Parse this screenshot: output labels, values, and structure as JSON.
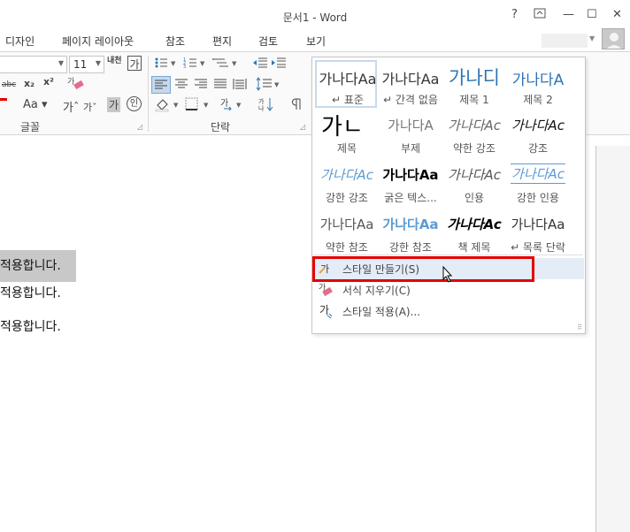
{
  "window": {
    "title": "문서1 - Word",
    "help": "?",
    "minimize": "—",
    "maximize": "☐",
    "close": "✕"
  },
  "tabs": [
    "디자인",
    "페이지 레이아웃",
    "참조",
    "편지",
    "검토",
    "보기"
  ],
  "ribbon": {
    "font_size": "11",
    "groups": [
      "글꼴",
      "단락"
    ],
    "hangul_label": "내천"
  },
  "document": {
    "lines": [
      "적용합니다.",
      "적용합니다.",
      "적용합니다."
    ]
  },
  "styles_gallery": {
    "styles": [
      {
        "preview": "가나다Aa",
        "name": "↵ 표준",
        "selected": true
      },
      {
        "preview": "가나다Aa",
        "name": "↵ 간격 없음"
      },
      {
        "preview": "가나디",
        "name": "제목 1"
      },
      {
        "preview": "가나다A",
        "name": "제목 2"
      },
      {
        "preview": "가ㄴ",
        "name": "제목"
      },
      {
        "preview": "가나다A",
        "name": "부제"
      },
      {
        "preview": "가나다Ac",
        "name": "약한 강조"
      },
      {
        "preview": "가나다Ac",
        "name": "강조"
      },
      {
        "preview": "가나다Ac",
        "name": "강한 강조"
      },
      {
        "preview": "가나다Aa",
        "name": "굵은 텍스..."
      },
      {
        "preview": "가나다Ac",
        "name": "인용"
      },
      {
        "preview": "가나다Ac",
        "name": "강한 인용"
      },
      {
        "preview": "가나다Aa",
        "name": "약한 참조"
      },
      {
        "preview": "가나다Aa",
        "name": "강한 참조"
      },
      {
        "preview": "가나다Ac",
        "name": "책 제목"
      },
      {
        "preview": "가나다Aa",
        "name": "↵ 목록 단락"
      }
    ],
    "menu": [
      {
        "label": "스타일 만들기(S)",
        "icon": "create-style-icon"
      },
      {
        "label": "서식 지우기(C)",
        "icon": "clear-formatting-icon"
      },
      {
        "label": "스타일 적용(A)...",
        "icon": "apply-styles-icon"
      }
    ]
  },
  "colors": {
    "highlight_red": "#e50000",
    "menu_hover": "#e4ecf7",
    "heading_blue": "#2e74b5",
    "selection_gray": "#c8c8c8"
  }
}
